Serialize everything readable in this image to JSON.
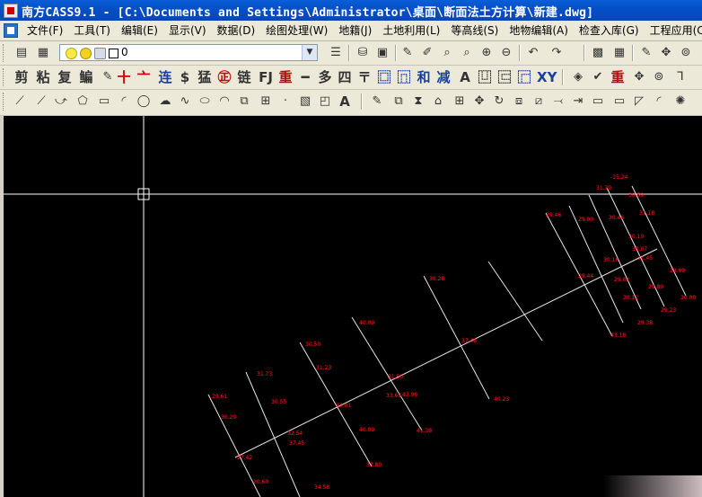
{
  "window": {
    "title": "南方CASS9.1 - [C:\\Documents and Settings\\Administrator\\桌面\\断面法土方计算\\新建.dwg]"
  },
  "menu": {
    "items": [
      "文件(F)",
      "工具(T)",
      "编辑(E)",
      "显示(V)",
      "数据(D)",
      "绘图处理(W)",
      "地籍(J)",
      "土地利用(L)",
      "等高线(S)",
      "地物编辑(A)",
      "检查入库(G)",
      "工程应用(C)"
    ]
  },
  "layer": {
    "current": "0"
  },
  "toolbar2": {
    "labels": [
      "剪",
      "粘",
      "复",
      "鳊",
      "✎",
      "十",
      "亠",
      "连",
      "$",
      "猛",
      "㊣",
      "链",
      "FJ",
      "重",
      "━",
      "多",
      "四",
      "〒",
      "⿴",
      "⿵",
      "和",
      "减",
      "A",
      "⿶",
      "⿷",
      "⿸",
      "XY",
      "◈",
      "✔",
      "重",
      "✥",
      "⊚",
      "⅂"
    ]
  },
  "colors": {
    "drawing": "#e6e6e6",
    "labels": "#ff1f1f",
    "background": "#000000",
    "crosshair": "#ffffff"
  },
  "drawing": {
    "labels": [
      "-15.24",
      "31.30",
      "30.59",
      "29.46",
      "29.90",
      "30.46",
      "31.18",
      "30.10",
      "30.07",
      "30.16",
      "31.45",
      "29.99",
      "29.44",
      "29.02",
      "29.80",
      "30.00",
      "30.12",
      "29.23",
      "29.38",
      "30.28",
      "43.18",
      "40.09",
      "30.50",
      "37.48",
      "31.73",
      "31.23",
      "33.01",
      "31.50",
      "33.65",
      "43.98",
      "40.23",
      "40.09",
      "29.61",
      "32.54",
      "33.80",
      "41.38",
      "30.20",
      "37.45",
      "30.55",
      "27.42",
      "20.60",
      "34.58"
    ]
  }
}
